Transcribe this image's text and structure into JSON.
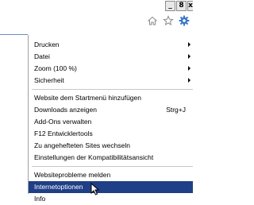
{
  "window_controls": {
    "minimize": "_",
    "maximize": "8",
    "close": "x"
  },
  "toolbar_icons": [
    "home-icon",
    "favorites-star-icon",
    "tools-gear-icon"
  ],
  "menu": {
    "group1": [
      {
        "label": "Drucken",
        "submenu": true
      },
      {
        "label": "Datei",
        "submenu": true
      },
      {
        "label": "Zoom (100 %)",
        "submenu": true
      },
      {
        "label": "Sicherheit",
        "submenu": true
      }
    ],
    "group2": [
      {
        "label": "Website dem Startmenü hinzufügen"
      },
      {
        "label": "Downloads anzeigen",
        "shortcut": "Strg+J"
      },
      {
        "label": "Add-Ons verwalten"
      },
      {
        "label": "F12 Entwicklertools"
      },
      {
        "label": "Zu angehefteten Sites wechseln"
      },
      {
        "label": "Einstellungen der Kompatibilitätsansicht"
      }
    ],
    "group3": [
      {
        "label": "Websiteprobleme melden"
      },
      {
        "label": "Internetoptionen",
        "selected": true
      },
      {
        "label": "Info"
      }
    ]
  },
  "colors": {
    "highlight": "#1f3f86",
    "star": "#f2b72b",
    "gear": "#3a76c4"
  }
}
